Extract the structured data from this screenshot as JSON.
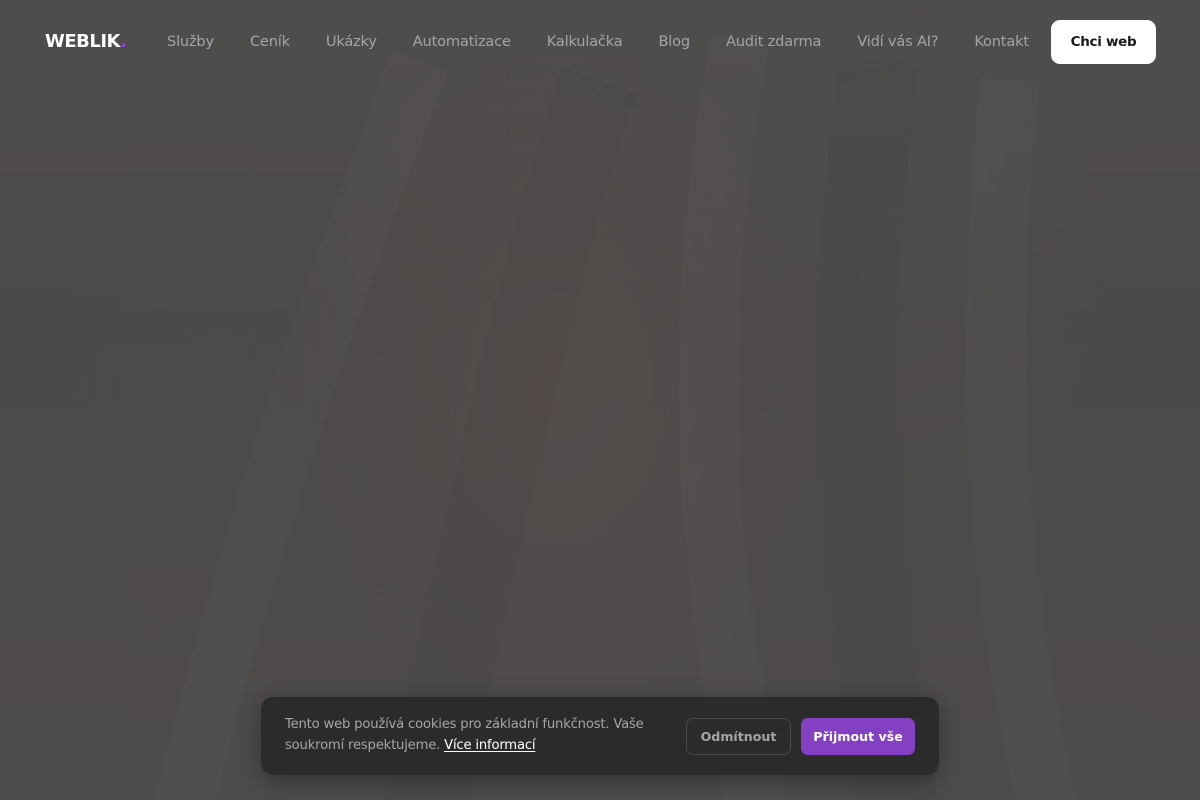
{
  "header": {
    "logo_text": "WEBLIK",
    "logo_dot": ".",
    "nav": [
      {
        "label": "Služby"
      },
      {
        "label": "Ceník"
      },
      {
        "label": "Ukázky"
      },
      {
        "label": "Automatizace"
      },
      {
        "label": "Kalkulačka"
      },
      {
        "label": "Blog"
      },
      {
        "label": "Audit zdarma"
      },
      {
        "label": "Vidí vás AI?"
      },
      {
        "label": "Kontakt"
      }
    ],
    "cta_label": "Chci web"
  },
  "cookie_banner": {
    "text": "Tento web používá cookies pro základní funkčnost. Vaše soukromí respektujeme.",
    "link_label": "Více informací",
    "decline_label": "Odmítnout",
    "accept_label": "Přijmout vše"
  },
  "colors": {
    "accent": "#8440c3",
    "background": "#535150",
    "banner_bg": "#2c2b2b",
    "nav_text": "#a6a2a8"
  }
}
